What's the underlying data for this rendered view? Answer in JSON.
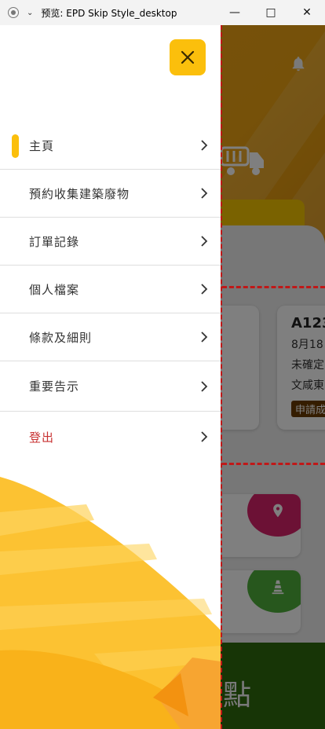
{
  "window": {
    "title": "预览: EPD Skip Style_desktop",
    "app_icon": "record-icon",
    "minimize_label": "—",
    "maximize_label": "□",
    "close_label": "✕"
  },
  "drawer": {
    "close_icon": "close-icon",
    "menu": [
      {
        "label": "主頁",
        "active": true
      },
      {
        "label": "預約收集建築廢物",
        "active": false
      },
      {
        "label": "訂單記錄",
        "active": false
      },
      {
        "label": "個人檔案",
        "active": false
      },
      {
        "label": "條款及細則",
        "active": false
      },
      {
        "label": "重要告示",
        "active": false
      },
      {
        "label": "登出",
        "active": false,
        "danger": true
      }
    ]
  },
  "background": {
    "card": {
      "code": "A123",
      "date": "8月18",
      "status": "未確定",
      "district": "文咸東",
      "badge": "申請成"
    },
    "bottom_banner": "點"
  },
  "colors": {
    "accent": "#fbbf0c",
    "hero": "#eda313",
    "danger": "#c83232",
    "indicator": "#c01818"
  }
}
